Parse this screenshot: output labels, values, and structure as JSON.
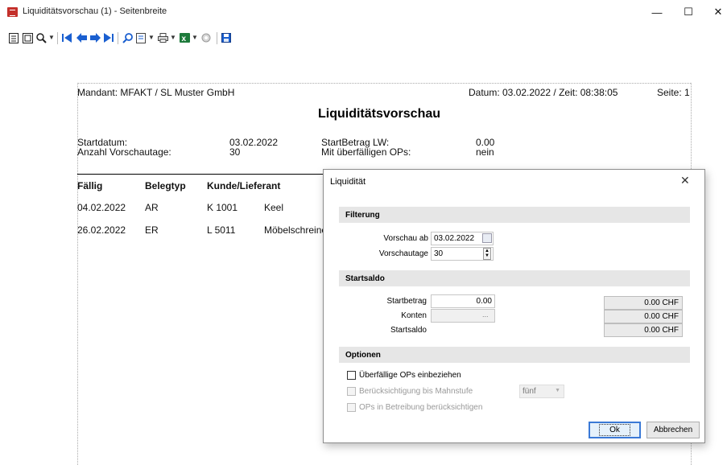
{
  "window": {
    "title": "Liquiditätsvorschau (1) - Seitenbreite",
    "minimize": "—",
    "maximize": "☐",
    "close": "✕"
  },
  "toolbar": {
    "icons": [
      "page-view-icon",
      "page-width-icon",
      "zoom-icon",
      "first-page-icon",
      "previous-page-icon",
      "next-page-icon",
      "last-page-icon",
      "search-icon",
      "export-icon",
      "print-icon",
      "excel-icon",
      "stop-icon",
      "save-icon"
    ]
  },
  "report": {
    "mandant": "Mandant: MFAKT / SL Muster GmbH",
    "datetime": "Datum: 03.02.2022 / Zeit: 08:38:05",
    "page": "Seite: 1",
    "title": "Liquiditätsvorschau",
    "startdatum_label": "Startdatum:",
    "startdatum_value": "03.02.2022",
    "vorschautage_label": "Anzahl Vorschautage:",
    "vorschautage_value": "30",
    "startbetrag_label": "StartBetrag LW:",
    "startbetrag_value": "0.00",
    "ueberfaellig_label": "Mit überfälligen OPs:",
    "ueberfaellig_value": "nein",
    "columns": [
      "Fällig",
      "Belegtyp",
      "Kunde/Lieferant"
    ],
    "rows": [
      {
        "faellig": "04.02.2022",
        "belegtyp": "AR",
        "kunde": "K 1001",
        "name": "Keel"
      },
      {
        "faellig": "26.02.2022",
        "belegtyp": "ER",
        "kunde": "L 5011",
        "name": "Möbelschreine"
      }
    ]
  },
  "dialog": {
    "title": "Liquidität",
    "close": "✕",
    "filterung": "Filterung",
    "vorschau_ab_label": "Vorschau ab",
    "vorschau_ab_value": "03.02.2022",
    "vorschautage_label": "Vorschautage",
    "vorschautage_value": "30",
    "startsaldo_section": "Startsaldo",
    "startbetrag_label": "Startbetrag",
    "startbetrag_value": "0.00",
    "startbetrag_chf": "0.00 CHF",
    "konten_label": "Konten",
    "konten_browse": "...",
    "konten_chf": "0.00 CHF",
    "startsaldo_label": "Startsaldo",
    "startsaldo_chf": "0.00 CHF",
    "optionen": "Optionen",
    "opt_ueberfaellig": "Überfällige OPs einbeziehen",
    "opt_mahnstufe": "Berücksichtigung bis Mahnstufe",
    "mahnstufe_value": "fünf",
    "opt_betreibung": "OPs in Betreibung berücksichtigen",
    "ok": "Ok",
    "abbrechen": "Abbrechen"
  }
}
